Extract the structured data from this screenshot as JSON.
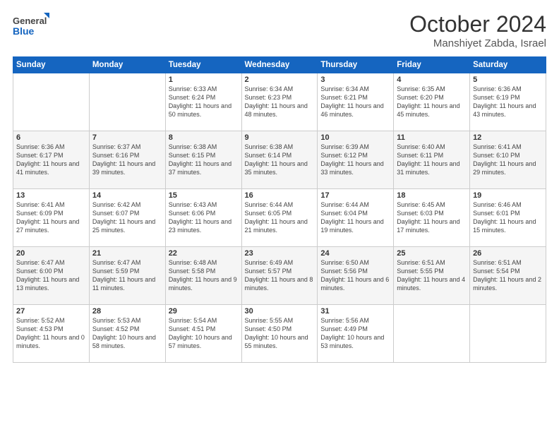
{
  "logo": {
    "general": "General",
    "blue": "Blue"
  },
  "title": "October 2024",
  "subtitle": "Manshiyet Zabda, Israel",
  "days_header": [
    "Sunday",
    "Monday",
    "Tuesday",
    "Wednesday",
    "Thursday",
    "Friday",
    "Saturday"
  ],
  "weeks": [
    [
      {
        "num": "",
        "detail": ""
      },
      {
        "num": "",
        "detail": ""
      },
      {
        "num": "1",
        "detail": "Sunrise: 6:33 AM\nSunset: 6:24 PM\nDaylight: 11 hours and 50 minutes."
      },
      {
        "num": "2",
        "detail": "Sunrise: 6:34 AM\nSunset: 6:23 PM\nDaylight: 11 hours and 48 minutes."
      },
      {
        "num": "3",
        "detail": "Sunrise: 6:34 AM\nSunset: 6:21 PM\nDaylight: 11 hours and 46 minutes."
      },
      {
        "num": "4",
        "detail": "Sunrise: 6:35 AM\nSunset: 6:20 PM\nDaylight: 11 hours and 45 minutes."
      },
      {
        "num": "5",
        "detail": "Sunrise: 6:36 AM\nSunset: 6:19 PM\nDaylight: 11 hours and 43 minutes."
      }
    ],
    [
      {
        "num": "6",
        "detail": "Sunrise: 6:36 AM\nSunset: 6:17 PM\nDaylight: 11 hours and 41 minutes."
      },
      {
        "num": "7",
        "detail": "Sunrise: 6:37 AM\nSunset: 6:16 PM\nDaylight: 11 hours and 39 minutes."
      },
      {
        "num": "8",
        "detail": "Sunrise: 6:38 AM\nSunset: 6:15 PM\nDaylight: 11 hours and 37 minutes."
      },
      {
        "num": "9",
        "detail": "Sunrise: 6:38 AM\nSunset: 6:14 PM\nDaylight: 11 hours and 35 minutes."
      },
      {
        "num": "10",
        "detail": "Sunrise: 6:39 AM\nSunset: 6:12 PM\nDaylight: 11 hours and 33 minutes."
      },
      {
        "num": "11",
        "detail": "Sunrise: 6:40 AM\nSunset: 6:11 PM\nDaylight: 11 hours and 31 minutes."
      },
      {
        "num": "12",
        "detail": "Sunrise: 6:41 AM\nSunset: 6:10 PM\nDaylight: 11 hours and 29 minutes."
      }
    ],
    [
      {
        "num": "13",
        "detail": "Sunrise: 6:41 AM\nSunset: 6:09 PM\nDaylight: 11 hours and 27 minutes."
      },
      {
        "num": "14",
        "detail": "Sunrise: 6:42 AM\nSunset: 6:07 PM\nDaylight: 11 hours and 25 minutes."
      },
      {
        "num": "15",
        "detail": "Sunrise: 6:43 AM\nSunset: 6:06 PM\nDaylight: 11 hours and 23 minutes."
      },
      {
        "num": "16",
        "detail": "Sunrise: 6:44 AM\nSunset: 6:05 PM\nDaylight: 11 hours and 21 minutes."
      },
      {
        "num": "17",
        "detail": "Sunrise: 6:44 AM\nSunset: 6:04 PM\nDaylight: 11 hours and 19 minutes."
      },
      {
        "num": "18",
        "detail": "Sunrise: 6:45 AM\nSunset: 6:03 PM\nDaylight: 11 hours and 17 minutes."
      },
      {
        "num": "19",
        "detail": "Sunrise: 6:46 AM\nSunset: 6:01 PM\nDaylight: 11 hours and 15 minutes."
      }
    ],
    [
      {
        "num": "20",
        "detail": "Sunrise: 6:47 AM\nSunset: 6:00 PM\nDaylight: 11 hours and 13 minutes."
      },
      {
        "num": "21",
        "detail": "Sunrise: 6:47 AM\nSunset: 5:59 PM\nDaylight: 11 hours and 11 minutes."
      },
      {
        "num": "22",
        "detail": "Sunrise: 6:48 AM\nSunset: 5:58 PM\nDaylight: 11 hours and 9 minutes."
      },
      {
        "num": "23",
        "detail": "Sunrise: 6:49 AM\nSunset: 5:57 PM\nDaylight: 11 hours and 8 minutes."
      },
      {
        "num": "24",
        "detail": "Sunrise: 6:50 AM\nSunset: 5:56 PM\nDaylight: 11 hours and 6 minutes."
      },
      {
        "num": "25",
        "detail": "Sunrise: 6:51 AM\nSunset: 5:55 PM\nDaylight: 11 hours and 4 minutes."
      },
      {
        "num": "26",
        "detail": "Sunrise: 6:51 AM\nSunset: 5:54 PM\nDaylight: 11 hours and 2 minutes."
      }
    ],
    [
      {
        "num": "27",
        "detail": "Sunrise: 5:52 AM\nSunset: 4:53 PM\nDaylight: 11 hours and 0 minutes."
      },
      {
        "num": "28",
        "detail": "Sunrise: 5:53 AM\nSunset: 4:52 PM\nDaylight: 10 hours and 58 minutes."
      },
      {
        "num": "29",
        "detail": "Sunrise: 5:54 AM\nSunset: 4:51 PM\nDaylight: 10 hours and 57 minutes."
      },
      {
        "num": "30",
        "detail": "Sunrise: 5:55 AM\nSunset: 4:50 PM\nDaylight: 10 hours and 55 minutes."
      },
      {
        "num": "31",
        "detail": "Sunrise: 5:56 AM\nSunset: 4:49 PM\nDaylight: 10 hours and 53 minutes."
      },
      {
        "num": "",
        "detail": ""
      },
      {
        "num": "",
        "detail": ""
      }
    ]
  ]
}
